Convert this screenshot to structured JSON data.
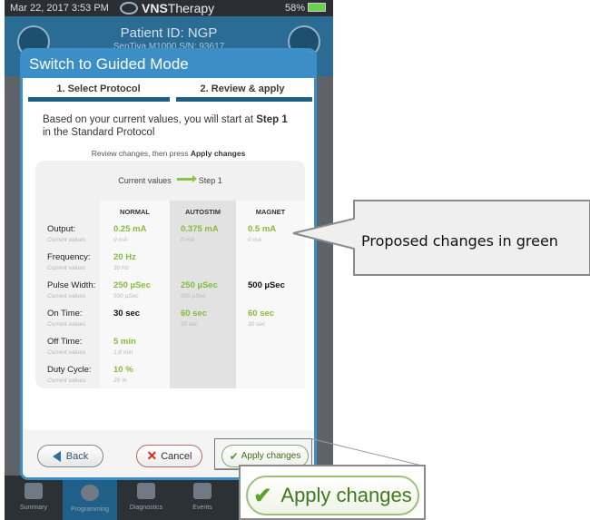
{
  "status": {
    "datetime": "Mar 22, 2017  3:53 PM",
    "app_name_bold": "VNS",
    "app_name_rest": "Therapy",
    "battery": "58%"
  },
  "header": {
    "patient": "Patient ID: NGP",
    "serial": "SenTiva M1000 S/N: 93617"
  },
  "modal": {
    "title": "Switch to Guided Mode",
    "steps": [
      "1. Select Protocol",
      "2. Review & apply"
    ],
    "intro_pre": "Based on your current values, you will start at ",
    "intro_bold": "Step 1",
    "intro_post": " in the Standard Protocol",
    "review_pre": "Review changes, then press ",
    "review_bold": "Apply changes",
    "legend_current": "Current values",
    "legend_step": "Step 1",
    "columns": [
      "NORMAL",
      "AUTOSTIM",
      "MAGNET"
    ],
    "sub_label": "Current values",
    "rows": [
      {
        "label": "Output:",
        "vals": [
          "0.25 mA",
          "0.375 mA",
          "0.5 mA"
        ],
        "subs": [
          "0 mA",
          "0 mA",
          "0 mA"
        ],
        "colors": [
          "green",
          "green",
          "green"
        ]
      },
      {
        "label": "Frequency:",
        "vals": [
          "20 Hz",
          "",
          ""
        ],
        "subs": [
          "30 Hz",
          "",
          ""
        ],
        "colors": [
          "green",
          "green",
          "green"
        ]
      },
      {
        "label": "Pulse Width:",
        "vals": [
          "250 µSec",
          "250 µSec",
          "500 µSec"
        ],
        "subs": [
          "500 µSec",
          "500 µSec",
          ""
        ],
        "colors": [
          "green",
          "green",
          "black"
        ]
      },
      {
        "label": "On Time:",
        "vals": [
          "30 sec",
          "60 sec",
          "60 sec"
        ],
        "subs": [
          "",
          "30 sec",
          "30 sec"
        ],
        "colors": [
          "black",
          "green",
          "green"
        ]
      },
      {
        "label": "Off Time:",
        "vals": [
          "5 min",
          "",
          ""
        ],
        "subs": [
          "1.8 min",
          "",
          ""
        ],
        "colors": [
          "green",
          "green",
          "green"
        ]
      },
      {
        "label": "Duty Cycle:",
        "vals": [
          "10 %",
          "",
          ""
        ],
        "subs": [
          "25 %",
          "",
          ""
        ],
        "colors": [
          "green",
          "green",
          "green"
        ]
      }
    ],
    "buttons": {
      "back": "Back",
      "cancel": "Cancel",
      "apply": "Apply changes"
    }
  },
  "tabs": [
    "Summary",
    "Programming",
    "Diagnostics",
    "Events"
  ],
  "callout": "Proposed changes in green",
  "zoom_apply": "Apply changes",
  "colors": {
    "accent": "#3b8fc6",
    "proposed": "#86bc3c"
  }
}
